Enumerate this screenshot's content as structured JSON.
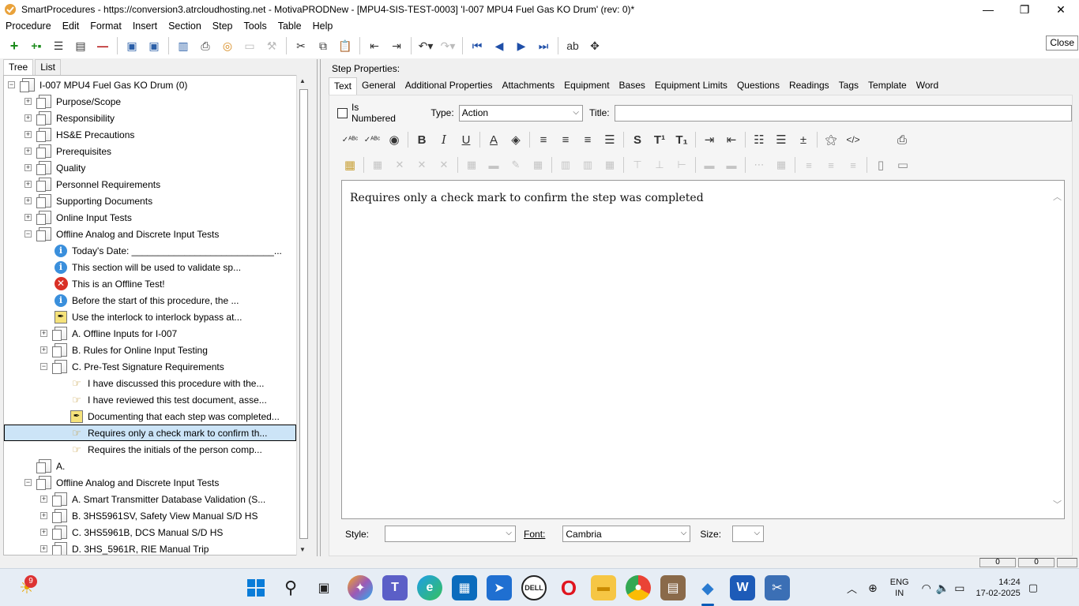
{
  "window": {
    "title": "SmartProcedures - https://conversion3.atrcloudhosting.net - MotivaPRODNew - [MPU4-SIS-TEST-0003] 'I-007 MPU4 Fuel Gas KO Drum' (rev: 0)*",
    "minimize": "—",
    "restore": "❐",
    "close": "✕"
  },
  "menu": [
    "Procedure",
    "Edit",
    "Format",
    "Insert",
    "Section",
    "Step",
    "Tools",
    "Table",
    "Help"
  ],
  "close_button": "Close",
  "left_tabs": [
    "Tree",
    "List"
  ],
  "tree": [
    {
      "label": "I-007 MPU4 Fuel Gas KO Drum (0)",
      "level": 0,
      "exp": "−",
      "icon": "doc"
    },
    {
      "label": "Purpose/Scope",
      "level": 1,
      "exp": "+",
      "icon": "doc"
    },
    {
      "label": "Responsibility",
      "level": 1,
      "exp": "+",
      "icon": "doc"
    },
    {
      "label": "HS&E Precautions",
      "level": 1,
      "exp": "+",
      "icon": "doc"
    },
    {
      "label": "Prerequisites",
      "level": 1,
      "exp": "+",
      "icon": "doc"
    },
    {
      "label": "Quality",
      "level": 1,
      "exp": "+",
      "icon": "doc"
    },
    {
      "label": "Personnel Requirements",
      "level": 1,
      "exp": "+",
      "icon": "doc"
    },
    {
      "label": "Supporting Documents",
      "level": 1,
      "exp": "+",
      "icon": "doc"
    },
    {
      "label": "Online Input Tests",
      "level": 1,
      "exp": "+",
      "icon": "doc"
    },
    {
      "label": "Offline Analog and Discrete Input Tests",
      "level": 1,
      "exp": "−",
      "icon": "doc"
    },
    {
      "label": "Today's Date: ___________________________...",
      "level": 2,
      "exp": "",
      "icon": "info"
    },
    {
      "label": "This section will be used to validate sp...",
      "level": 2,
      "exp": "",
      "icon": "info"
    },
    {
      "label": "This is an Offline Test!",
      "level": 2,
      "exp": "",
      "icon": "err"
    },
    {
      "label": "Before the start of this procedure, the ...",
      "level": 2,
      "exp": "",
      "icon": "info"
    },
    {
      "label": "Use the interlock to interlock bypass at...",
      "level": 2,
      "exp": "",
      "icon": "sign"
    },
    {
      "label": "A. Offline Inputs for I-007",
      "level": 2,
      "exp": "+",
      "icon": "doc"
    },
    {
      "label": "B. Rules for Online Input Testing",
      "level": 2,
      "exp": "+",
      "icon": "doc"
    },
    {
      "label": "C. Pre-Test Signature Requirements",
      "level": 2,
      "exp": "−",
      "icon": "doc"
    },
    {
      "label": "I have discussed this procedure with the...",
      "level": 3,
      "exp": "",
      "icon": "hand"
    },
    {
      "label": "I have reviewed this test document, asse...",
      "level": 3,
      "exp": "",
      "icon": "hand"
    },
    {
      "label": "Documenting that each step was completed...",
      "level": 3,
      "exp": "",
      "icon": "sign"
    },
    {
      "label": "Requires only a check mark to confirm th...",
      "level": 3,
      "exp": "",
      "icon": "hand",
      "selected": true
    },
    {
      "label": "Requires the initials of the person comp...",
      "level": 3,
      "exp": "",
      "icon": "hand"
    },
    {
      "label": "A.",
      "level": 1,
      "exp": "",
      "icon": "doc"
    },
    {
      "label": "Offline Analog and Discrete Input Tests",
      "level": 1,
      "exp": "−",
      "icon": "doc"
    },
    {
      "label": "A. Smart Transmitter Database Validation (S...",
      "level": 2,
      "exp": "+",
      "icon": "doc"
    },
    {
      "label": "B. 3HS5961SV, Safety View Manual S/D HS",
      "level": 2,
      "exp": "+",
      "icon": "doc"
    },
    {
      "label": "C. 3HS5961B, DCS Manual S/D HS",
      "level": 2,
      "exp": "+",
      "icon": "doc"
    },
    {
      "label": "D. 3HS_5961R, RIE Manual Trip",
      "level": 2,
      "exp": "+",
      "icon": "doc"
    }
  ],
  "props": {
    "title": "Step Properties:",
    "tabs": [
      "Text",
      "General",
      "Additional Properties",
      "Attachments",
      "Equipment",
      "Bases",
      "Equipment Limits",
      "Questions",
      "Readings",
      "Tags",
      "Template",
      "Word"
    ],
    "is_numbered_label": "Is Numbered",
    "type_label": "Type:",
    "type_value": "Action",
    "title_label": "Title:",
    "title_value": "",
    "editor_text": "Requires only a check mark to confirm the step was completed",
    "style_label": "Style:",
    "style_value": "",
    "font_label": "Font:",
    "font_value": "Cambria",
    "size_label": "Size:",
    "size_value": ""
  },
  "status": {
    "cell1": "0",
    "cell2": "0"
  },
  "taskbar": {
    "notification_badge": "9",
    "lang": "ENG",
    "region": "IN",
    "time": "14:24",
    "date": "17-02-2025"
  }
}
